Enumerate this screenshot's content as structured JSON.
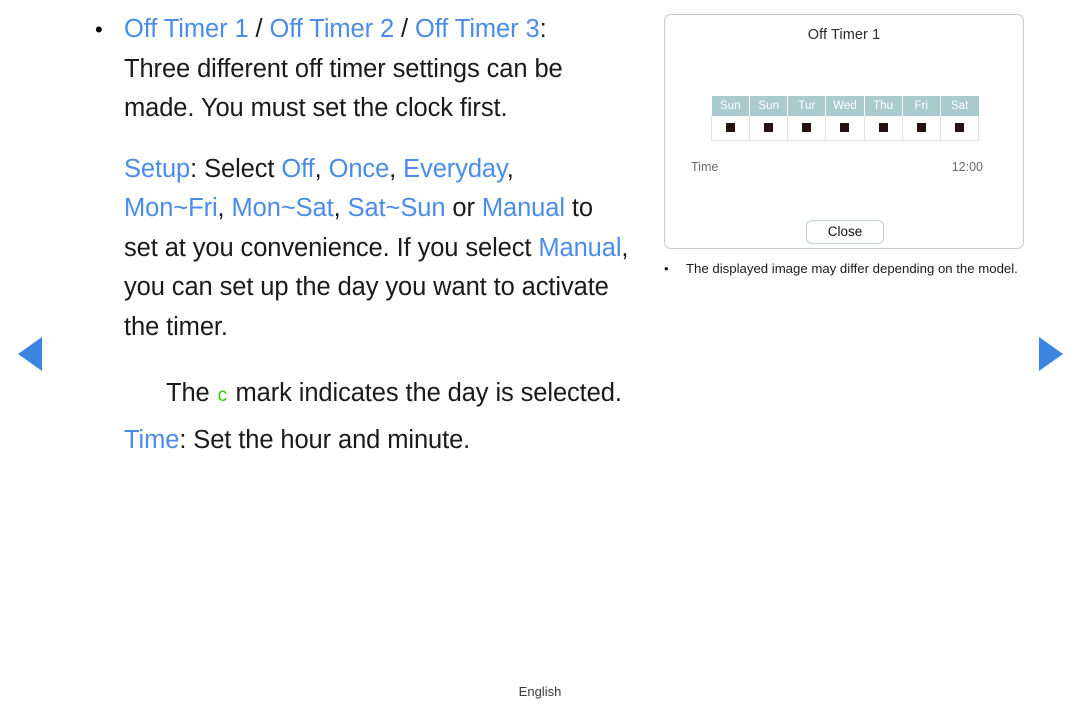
{
  "nav": {
    "prev_label": "previous-page",
    "next_label": "next-page",
    "arrow_color": "#3b84e0"
  },
  "colors": {
    "link_blue": "#4a8ce8",
    "mark_green": "#2ecc00",
    "table_header_teal": "#a9cbcd",
    "body_black": "#1a1a1a"
  },
  "content": {
    "bullet_glyph": "•",
    "heading": {
      "item_1": "Off Timer 1",
      "sep_1": " / ",
      "item_2": "Off Timer 2",
      "sep_2": " / ",
      "item_3": "Off Timer 3",
      "colon": ":"
    },
    "description_line_1": "Three different off timer settings can be",
    "description_line_2": "made. You must set the clock first.",
    "setup": {
      "label": "Setup",
      "colon_select": ": Select ",
      "opt_off": "Off",
      "comma_1": ", ",
      "opt_once": "Once",
      "comma_2": ", ",
      "opt_everyday": "Everyday",
      "comma_3": ",",
      "opt_mon_fri": "Mon~Fri",
      "comma_4": ", ",
      "opt_mon_sat": "Mon~Sat",
      "comma_5": ", ",
      "opt_sat_sun": "Sat~Sun",
      "or": " or ",
      "opt_manual": "Manual",
      "to": " to",
      "tail_1_a": "set at you convenience. If you select ",
      "tail_1_manual": "Manual",
      "tail_1_b": ",",
      "tail_2": "you can set up the day you want to activate",
      "tail_3": "the timer."
    },
    "mark_note": {
      "prefix": "The ",
      "mark_glyph": "c",
      "suffix": "mark indicates the day is selected."
    },
    "time_line": {
      "label": "Time",
      "text": ": Set the hour and minute."
    }
  },
  "osd": {
    "title": "Off Timer 1",
    "day_headers": [
      "Sun",
      "Sun",
      "Tur",
      "Wed",
      "Thu",
      "Fri",
      "Sat"
    ],
    "day_marks": [
      "■",
      "■",
      "■",
      "■",
      "■",
      "■",
      "■"
    ],
    "time_label": "Time",
    "time_value": "12:00",
    "close_label": "Close"
  },
  "note": {
    "bullet_glyph": "•",
    "text": "The displayed image may differ depending on the model."
  },
  "footer": {
    "language": "English"
  }
}
